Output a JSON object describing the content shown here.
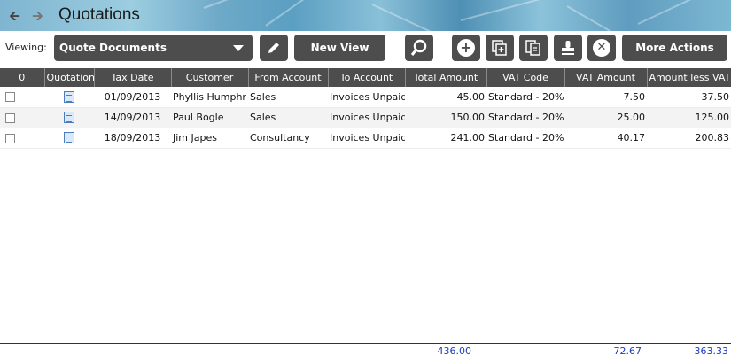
{
  "header": {
    "title": "Quotations",
    "back_icon": "back-arrow-icon",
    "forward_icon": "forward-arrow-icon"
  },
  "toolbar": {
    "viewing_label": "Viewing:",
    "view_select_value": "Quote Documents",
    "new_view_label": "New View",
    "more_actions_label": "More Actions",
    "icons": [
      "edit-pencil-icon",
      "search-icon",
      "add-icon",
      "copy-add-icon",
      "copy-document-icon",
      "stamp-icon",
      "delete-icon"
    ]
  },
  "grid": {
    "columns": [
      "0",
      "Quotation ...",
      "Tax Date",
      "Customer",
      "From Account",
      "To Account",
      "Total Amount",
      "VAT Code",
      "VAT Amount",
      "Amount less VAT"
    ],
    "rows": [
      {
        "tax_date": "01/09/2013",
        "customer": "Phyllis Humphr",
        "from": "Sales",
        "to": "Invoices Unpaid",
        "total": "45.00",
        "vat_code": "Standard - 20%",
        "vat_amount": "7.50",
        "less_vat": "37.50"
      },
      {
        "tax_date": "14/09/2013",
        "customer": "Paul Bogle",
        "from": "Sales",
        "to": "Invoices Unpaid",
        "total": "150.00",
        "vat_code": "Standard - 20%",
        "vat_amount": "25.00",
        "less_vat": "125.00"
      },
      {
        "tax_date": "18/09/2013",
        "customer": "Jim Japes",
        "from": "Consultancy",
        "to": "Invoices Unpaid",
        "total": "241.00",
        "vat_code": "Standard - 20%",
        "vat_amount": "40.17",
        "less_vat": "200.83"
      }
    ]
  },
  "totals": {
    "total_amount": "436.00",
    "vat_amount": "72.67",
    "amount_less_vat": "363.33"
  },
  "colors": {
    "toolbar_button": "#4d4d4d",
    "total_text": "#1a3bb8"
  }
}
